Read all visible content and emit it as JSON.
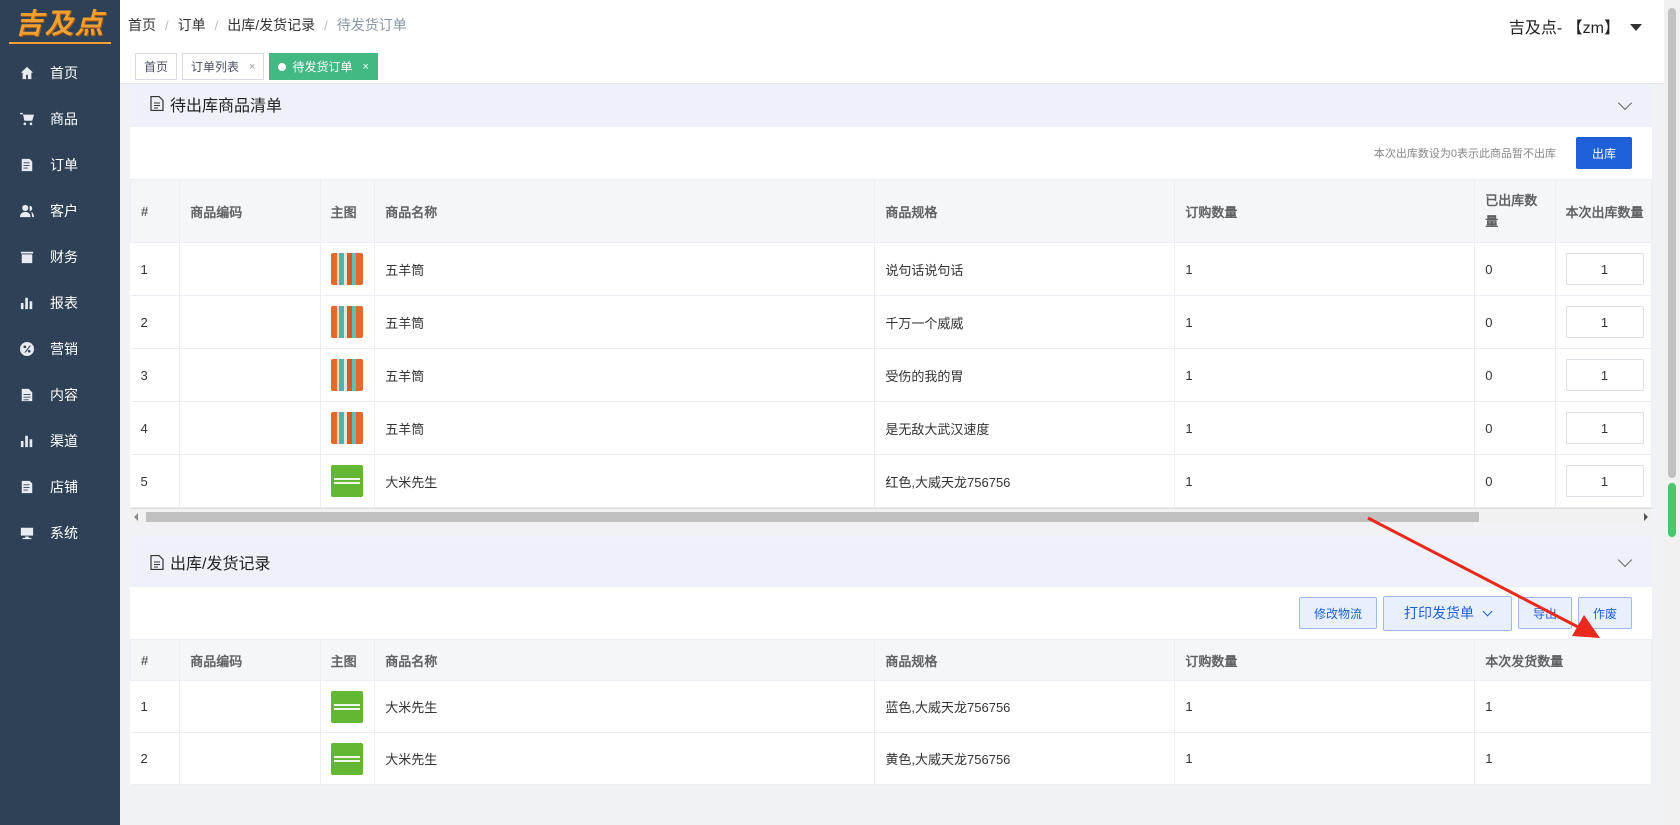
{
  "logo": {
    "text": "吉及点"
  },
  "sidebar": {
    "items": [
      {
        "label": "首页",
        "icon": "home-icon"
      },
      {
        "label": "商品",
        "icon": "cart-icon"
      },
      {
        "label": "订单",
        "icon": "order-icon"
      },
      {
        "label": "客户",
        "icon": "customer-icon"
      },
      {
        "label": "财务",
        "icon": "finance-icon"
      },
      {
        "label": "报表",
        "icon": "chart-icon"
      },
      {
        "label": "营销",
        "icon": "marketing-icon"
      },
      {
        "label": "内容",
        "icon": "content-icon"
      },
      {
        "label": "渠道",
        "icon": "channel-icon"
      },
      {
        "label": "店铺",
        "icon": "shop-icon"
      },
      {
        "label": "系统",
        "icon": "system-icon"
      }
    ]
  },
  "breadcrumb": [
    "首页",
    "订单",
    "出库/发货记录",
    "待发货订单"
  ],
  "user": {
    "name": "吉及点- 【zm】"
  },
  "tabs": [
    {
      "label": "首页"
    },
    {
      "label": "订单列表",
      "close": "×"
    },
    {
      "label": "待发货订单",
      "close": "×"
    }
  ],
  "pending": {
    "title": "待出库商品清单",
    "hint": "本次出库数设为0表示此商品暂不出库",
    "out_button": "出库",
    "columns": [
      "#",
      "商品编码",
      "主图",
      "商品名称",
      "商品规格",
      "订购数量",
      "已出库数量",
      "本次出库数量"
    ],
    "rows": [
      {
        "no": "1",
        "code": "",
        "image": "tubes",
        "name": "五羊筒",
        "spec": "说句话说句话",
        "ordered": "1",
        "shipped": "0",
        "qty": "1"
      },
      {
        "no": "2",
        "code": "",
        "image": "tubes",
        "name": "五羊筒",
        "spec": "千万一个威威",
        "ordered": "1",
        "shipped": "0",
        "qty": "1"
      },
      {
        "no": "3",
        "code": "",
        "image": "tubes",
        "name": "五羊筒",
        "spec": "受伤的我的胃",
        "ordered": "1",
        "shipped": "0",
        "qty": "1"
      },
      {
        "no": "4",
        "code": "",
        "image": "tubes",
        "name": "五羊筒",
        "spec": "是无敌大武汉速度",
        "ordered": "1",
        "shipped": "0",
        "qty": "1"
      },
      {
        "no": "5",
        "code": "",
        "image": "rice",
        "name": "大米先生",
        "spec": "红色,大威天龙756756",
        "ordered": "1",
        "shipped": "0",
        "qty": "1"
      }
    ]
  },
  "records": {
    "title": "出库/发货记录",
    "buttons": {
      "modify": "修改物流",
      "print": "打印发货单",
      "export": "导出",
      "void": "作废"
    },
    "columns": [
      "#",
      "商品编码",
      "主图",
      "商品名称",
      "商品规格",
      "订购数量",
      "本次发货数量"
    ],
    "rows": [
      {
        "no": "1",
        "code": "",
        "image": "rice",
        "name": "大米先生",
        "spec": "蓝色,大威天龙756756",
        "ordered": "1",
        "sent": "1"
      },
      {
        "no": "2",
        "code": "",
        "image": "rice",
        "name": "大米先生",
        "spec": "黄色,大威天龙756756",
        "ordered": "1",
        "sent": "1"
      }
    ]
  },
  "colors": {
    "sidebar": "#2f4156",
    "active_tab": "#42b983",
    "primary": "#1f5fd8",
    "arrow": "#e8291c"
  }
}
